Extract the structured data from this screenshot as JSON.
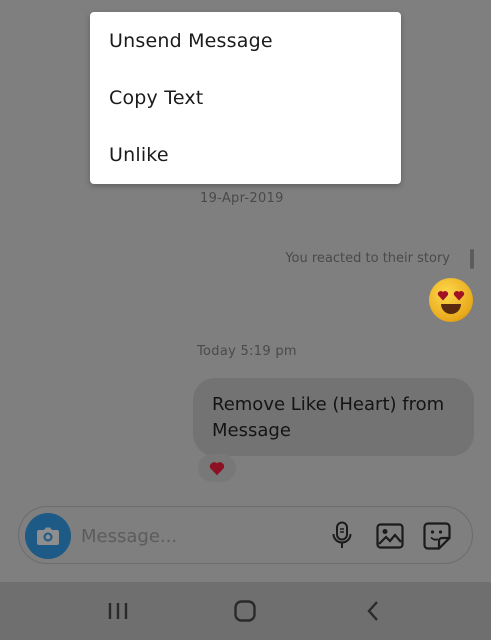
{
  "menu": {
    "items": [
      {
        "label": "Unsend Message"
      },
      {
        "label": "Copy Text"
      },
      {
        "label": "Unlike"
      }
    ]
  },
  "chat": {
    "date_1": "19-Apr-2019",
    "reacted_note": "You reacted to their story",
    "date_2": "Today 5:19 pm",
    "message_text": "Remove Like (Heart) from Message",
    "reaction": "heart-icon"
  },
  "composer": {
    "placeholder": "Message...",
    "icons": [
      "camera-icon",
      "mic-icon",
      "gallery-icon",
      "sticker-icon"
    ]
  },
  "navbar": {
    "icons": [
      "recent-apps-icon",
      "home-icon",
      "back-icon"
    ]
  },
  "colors": {
    "overlay_bg": "#7f7f7f",
    "menu_bg": "#ffffff",
    "camera_btn": "#1e5a86",
    "heart": "#b3122b"
  }
}
